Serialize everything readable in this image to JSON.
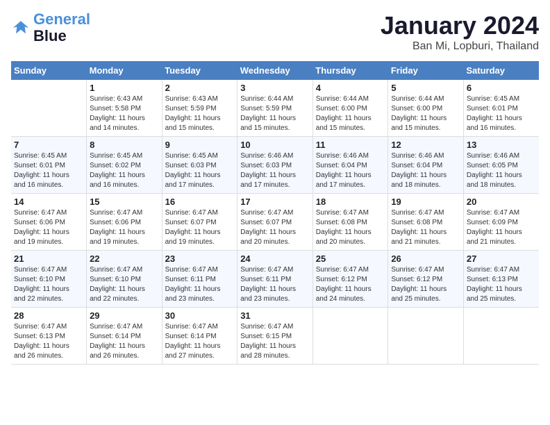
{
  "header": {
    "logo_line1": "General",
    "logo_line2": "Blue",
    "month": "January 2024",
    "location": "Ban Mi, Lopburi, Thailand"
  },
  "weekdays": [
    "Sunday",
    "Monday",
    "Tuesday",
    "Wednesday",
    "Thursday",
    "Friday",
    "Saturday"
  ],
  "weeks": [
    [
      {
        "day": "",
        "info": ""
      },
      {
        "day": "1",
        "info": "Sunrise: 6:43 AM\nSunset: 5:58 PM\nDaylight: 11 hours\nand 14 minutes."
      },
      {
        "day": "2",
        "info": "Sunrise: 6:43 AM\nSunset: 5:59 PM\nDaylight: 11 hours\nand 15 minutes."
      },
      {
        "day": "3",
        "info": "Sunrise: 6:44 AM\nSunset: 5:59 PM\nDaylight: 11 hours\nand 15 minutes."
      },
      {
        "day": "4",
        "info": "Sunrise: 6:44 AM\nSunset: 6:00 PM\nDaylight: 11 hours\nand 15 minutes."
      },
      {
        "day": "5",
        "info": "Sunrise: 6:44 AM\nSunset: 6:00 PM\nDaylight: 11 hours\nand 15 minutes."
      },
      {
        "day": "6",
        "info": "Sunrise: 6:45 AM\nSunset: 6:01 PM\nDaylight: 11 hours\nand 16 minutes."
      }
    ],
    [
      {
        "day": "7",
        "info": "Sunrise: 6:45 AM\nSunset: 6:01 PM\nDaylight: 11 hours\nand 16 minutes."
      },
      {
        "day": "8",
        "info": "Sunrise: 6:45 AM\nSunset: 6:02 PM\nDaylight: 11 hours\nand 16 minutes."
      },
      {
        "day": "9",
        "info": "Sunrise: 6:45 AM\nSunset: 6:03 PM\nDaylight: 11 hours\nand 17 minutes."
      },
      {
        "day": "10",
        "info": "Sunrise: 6:46 AM\nSunset: 6:03 PM\nDaylight: 11 hours\nand 17 minutes."
      },
      {
        "day": "11",
        "info": "Sunrise: 6:46 AM\nSunset: 6:04 PM\nDaylight: 11 hours\nand 17 minutes."
      },
      {
        "day": "12",
        "info": "Sunrise: 6:46 AM\nSunset: 6:04 PM\nDaylight: 11 hours\nand 18 minutes."
      },
      {
        "day": "13",
        "info": "Sunrise: 6:46 AM\nSunset: 6:05 PM\nDaylight: 11 hours\nand 18 minutes."
      }
    ],
    [
      {
        "day": "14",
        "info": "Sunrise: 6:47 AM\nSunset: 6:06 PM\nDaylight: 11 hours\nand 19 minutes."
      },
      {
        "day": "15",
        "info": "Sunrise: 6:47 AM\nSunset: 6:06 PM\nDaylight: 11 hours\nand 19 minutes."
      },
      {
        "day": "16",
        "info": "Sunrise: 6:47 AM\nSunset: 6:07 PM\nDaylight: 11 hours\nand 19 minutes."
      },
      {
        "day": "17",
        "info": "Sunrise: 6:47 AM\nSunset: 6:07 PM\nDaylight: 11 hours\nand 20 minutes."
      },
      {
        "day": "18",
        "info": "Sunrise: 6:47 AM\nSunset: 6:08 PM\nDaylight: 11 hours\nand 20 minutes."
      },
      {
        "day": "19",
        "info": "Sunrise: 6:47 AM\nSunset: 6:08 PM\nDaylight: 11 hours\nand 21 minutes."
      },
      {
        "day": "20",
        "info": "Sunrise: 6:47 AM\nSunset: 6:09 PM\nDaylight: 11 hours\nand 21 minutes."
      }
    ],
    [
      {
        "day": "21",
        "info": "Sunrise: 6:47 AM\nSunset: 6:10 PM\nDaylight: 11 hours\nand 22 minutes."
      },
      {
        "day": "22",
        "info": "Sunrise: 6:47 AM\nSunset: 6:10 PM\nDaylight: 11 hours\nand 22 minutes."
      },
      {
        "day": "23",
        "info": "Sunrise: 6:47 AM\nSunset: 6:11 PM\nDaylight: 11 hours\nand 23 minutes."
      },
      {
        "day": "24",
        "info": "Sunrise: 6:47 AM\nSunset: 6:11 PM\nDaylight: 11 hours\nand 23 minutes."
      },
      {
        "day": "25",
        "info": "Sunrise: 6:47 AM\nSunset: 6:12 PM\nDaylight: 11 hours\nand 24 minutes."
      },
      {
        "day": "26",
        "info": "Sunrise: 6:47 AM\nSunset: 6:12 PM\nDaylight: 11 hours\nand 25 minutes."
      },
      {
        "day": "27",
        "info": "Sunrise: 6:47 AM\nSunset: 6:13 PM\nDaylight: 11 hours\nand 25 minutes."
      }
    ],
    [
      {
        "day": "28",
        "info": "Sunrise: 6:47 AM\nSunset: 6:13 PM\nDaylight: 11 hours\nand 26 minutes."
      },
      {
        "day": "29",
        "info": "Sunrise: 6:47 AM\nSunset: 6:14 PM\nDaylight: 11 hours\nand 26 minutes."
      },
      {
        "day": "30",
        "info": "Sunrise: 6:47 AM\nSunset: 6:14 PM\nDaylight: 11 hours\nand 27 minutes."
      },
      {
        "day": "31",
        "info": "Sunrise: 6:47 AM\nSunset: 6:15 PM\nDaylight: 11 hours\nand 28 minutes."
      },
      {
        "day": "",
        "info": ""
      },
      {
        "day": "",
        "info": ""
      },
      {
        "day": "",
        "info": ""
      }
    ]
  ]
}
